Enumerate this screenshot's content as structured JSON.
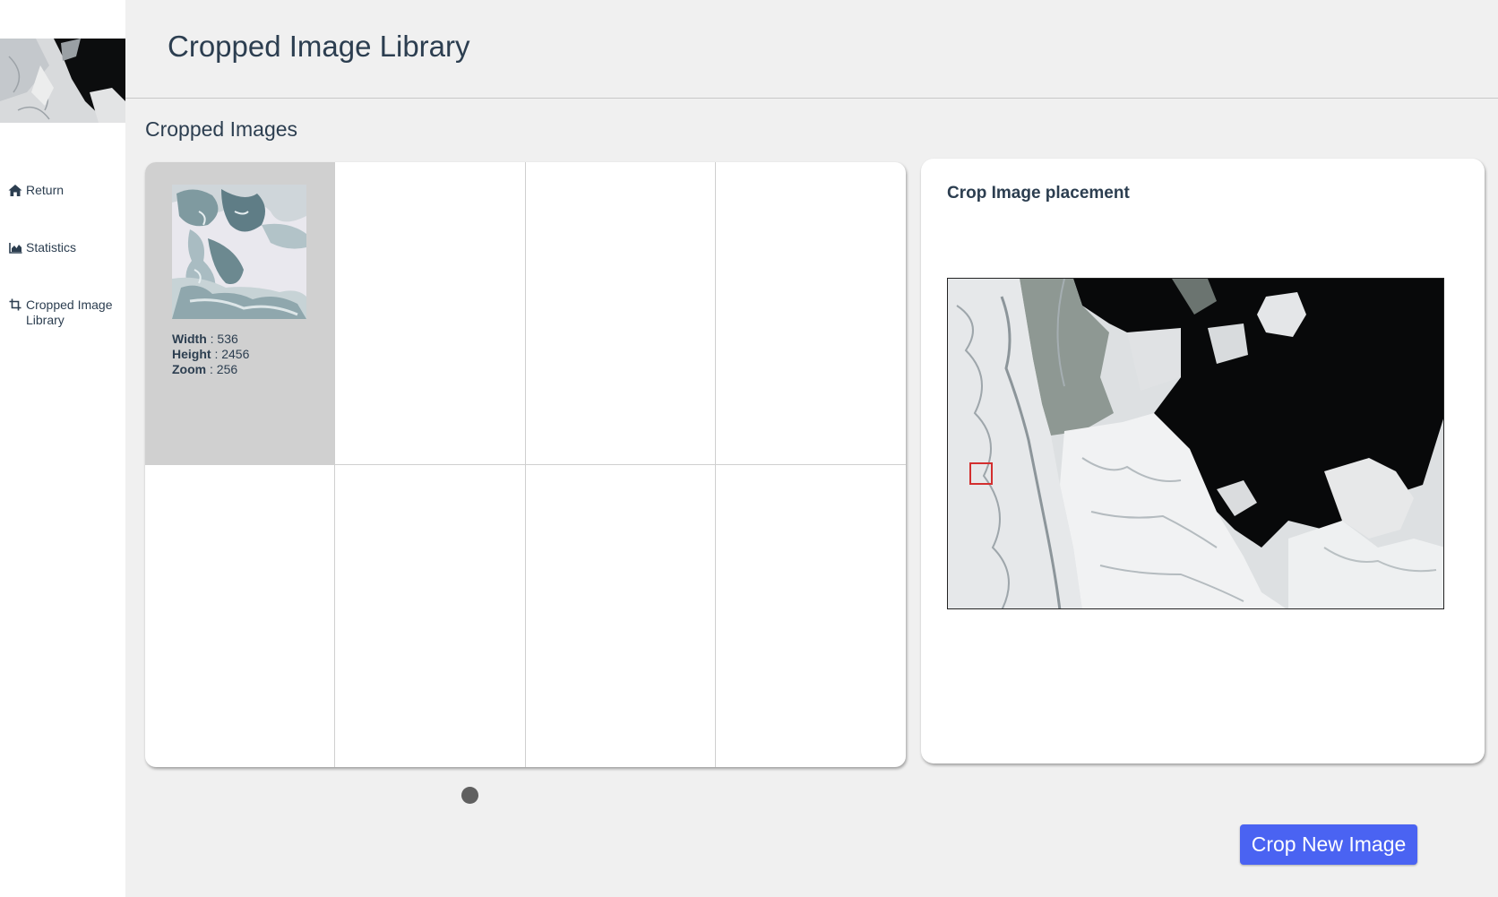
{
  "app": {
    "title": "Cropped Image Library"
  },
  "sidebar": {
    "items": [
      {
        "label": "Return",
        "icon": "home-icon"
      },
      {
        "label": "Statistics",
        "icon": "chart-area-icon"
      },
      {
        "label": "Cropped Image Library",
        "icon": "crop-icon"
      }
    ]
  },
  "section": {
    "title": "Cropped Images"
  },
  "crops": [
    {
      "width_label": "Width",
      "width": "536",
      "height_label": "Height",
      "height": "2456",
      "zoom_label": "Zoom",
      "zoom": "256"
    }
  ],
  "placement": {
    "title": "Crop Image placement",
    "marker_color": "#d32f2f"
  },
  "actions": {
    "crop_new": "Crop New Image"
  },
  "colors": {
    "accent": "#4a63f2",
    "text": "#2c3e50",
    "selected_cell": "#d0d0d0"
  }
}
